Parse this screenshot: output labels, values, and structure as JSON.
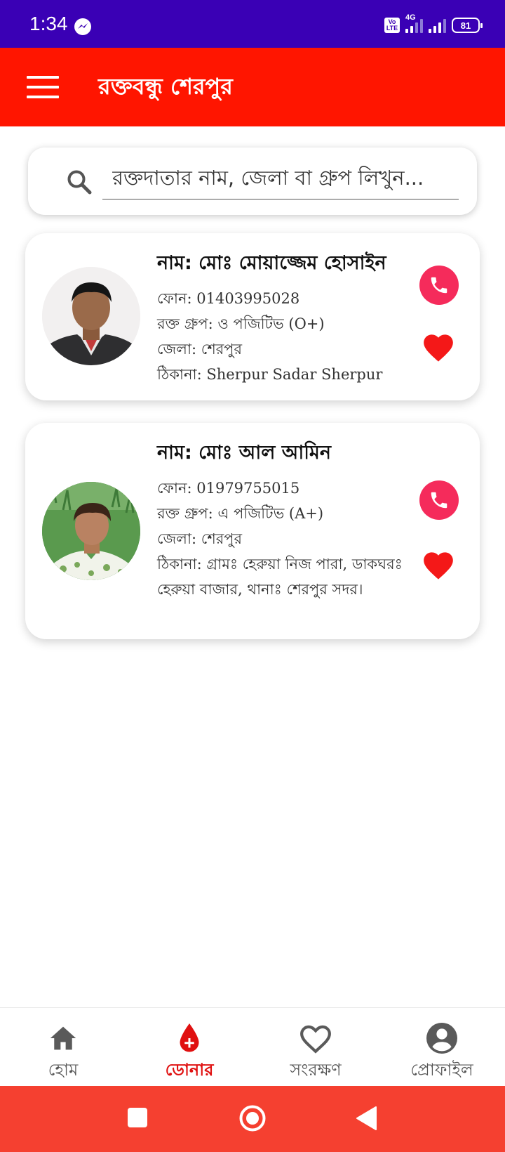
{
  "status_bar": {
    "time": "1:34",
    "network": "4G",
    "volte": "Vo LTE",
    "battery": "81"
  },
  "app_bar": {
    "title": "রক্তবন্ধু শেরপুর"
  },
  "search": {
    "placeholder": "রক্তদাতার নাম, জেলা বা গ্রুপ লিখুন..."
  },
  "donors": [
    {
      "name": "নাম: মোঃ মোয়াজ্জেম হোসাইন",
      "phone": "ফোন: 01403995028",
      "blood_group": "রক্ত গ্রুপ: ও পজিটিভ (O+)",
      "district": "জেলা: শেরপুর",
      "address": "ঠিকানা: Sherpur Sadar Sherpur"
    },
    {
      "name": "নাম: মোঃ আল আমিন",
      "phone": "ফোন: 01979755015",
      "blood_group": "রক্ত গ্রুপ: এ পজিটিভ (A+)",
      "district": "জেলা: শেরপুর",
      "address": "ঠিকানা: গ্রামঃ হেরুয়া নিজ পারা, ডাকঘরঃ হেরুয়া বাজার, থানাঃ শেরপুর সদর।"
    }
  ],
  "bottom_nav": [
    {
      "label": "হোম",
      "icon": "home-icon"
    },
    {
      "label": "ডোনার",
      "icon": "blood-drop-icon",
      "active": true
    },
    {
      "label": "সংরক্ষণ",
      "icon": "heart-outline-icon"
    },
    {
      "label": "প্রোফাইল",
      "icon": "account-circle-icon"
    }
  ],
  "colors": {
    "status_bar": "#3a00b5",
    "app_bar": "#ff1500",
    "call": "#f52b5b",
    "heart": "#f41818",
    "nav_active": "#e01010",
    "system_nav": "#f54030"
  }
}
